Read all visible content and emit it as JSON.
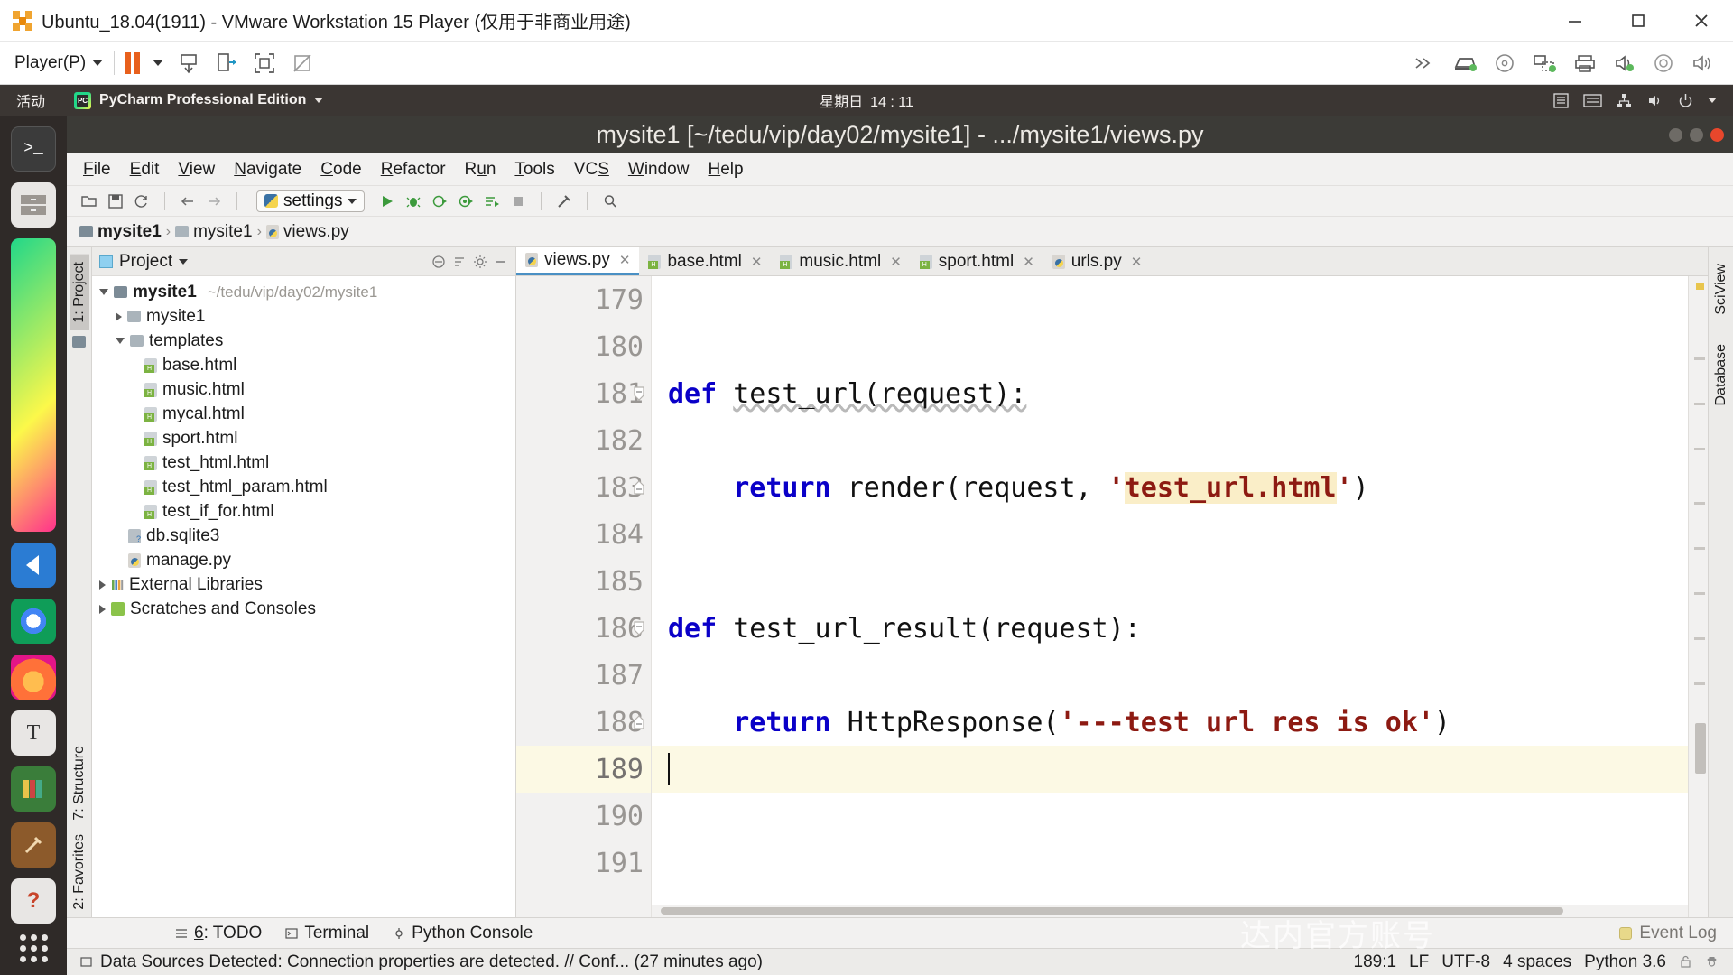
{
  "vmware": {
    "title": "Ubuntu_18.04(1911) - VMware Workstation 15 Player (仅用于非商业用途)",
    "minimize_label": "Minimize",
    "maximize_label": "Maximize",
    "close_label": "Close",
    "player_menu": "Player(P)",
    "toolbar_icons": [
      "pause-icon",
      "dropdown-icon",
      "send-ctrl-alt-del-icon",
      "unity-mode-icon",
      "full-screen-icon",
      "no-preview-icon"
    ],
    "right_icons": [
      "expand-chevrons-icon",
      "hard-disk-icon",
      "cd-dvd-icon",
      "network-adapter-icon",
      "printer-icon",
      "sound-card-icon",
      "usb-device-icon",
      "speaker-icon"
    ]
  },
  "ubuntu": {
    "activities": "活动",
    "app_name": "PyCharm Professional Edition",
    "app_icon": "pycharm-icon",
    "clock_day": "星期日",
    "clock_time": "14 : 11",
    "tray_icons": [
      "keyboard-input-icon",
      "ime-icon",
      "network-icon",
      "volume-icon",
      "power-icon"
    ],
    "launcher_items": [
      {
        "name": "terminal",
        "label": "Terminal"
      },
      {
        "name": "files",
        "label": "Files"
      },
      {
        "name": "pycharm",
        "label": "PyCharm"
      },
      {
        "name": "vscode",
        "label": "Visual Studio Code"
      },
      {
        "name": "chrome",
        "label": "Google Chrome"
      },
      {
        "name": "firefox",
        "label": "Firefox"
      },
      {
        "name": "text-editor",
        "label": "Text Editor"
      },
      {
        "name": "books",
        "label": "Books"
      },
      {
        "name": "tools",
        "label": "Tools"
      },
      {
        "name": "help",
        "label": "Help"
      },
      {
        "name": "show-applications",
        "label": "Show Applications"
      }
    ]
  },
  "pycharm": {
    "window_title": "mysite1 [~/tedu/vip/day02/mysite1] - .../mysite1/views.py",
    "menu": [
      {
        "label": "File",
        "mnemonic": "F"
      },
      {
        "label": "Edit",
        "mnemonic": "E"
      },
      {
        "label": "View",
        "mnemonic": "V"
      },
      {
        "label": "Navigate",
        "mnemonic": "N"
      },
      {
        "label": "Code",
        "mnemonic": "C"
      },
      {
        "label": "Refactor",
        "mnemonic": "R"
      },
      {
        "label": "Run",
        "mnemonic": "u"
      },
      {
        "label": "Tools",
        "mnemonic": "T"
      },
      {
        "label": "VCS",
        "mnemonic": "S"
      },
      {
        "label": "Window",
        "mnemonic": "W"
      },
      {
        "label": "Help",
        "mnemonic": "H"
      }
    ],
    "toolbar": {
      "open_label": "Open",
      "save_label": "Save All",
      "sync_label": "Synchronize",
      "back_label": "Back",
      "forward_label": "Forward",
      "run_config": "settings",
      "run_label": "Run",
      "debug_label": "Debug",
      "run_coverage_label": "Run with Coverage",
      "profile_label": "Profile",
      "attach_label": "Attach to Process",
      "stop_label": "Stop",
      "settings_label": "Settings",
      "search_label": "Search Everywhere"
    },
    "breadcrumb": [
      {
        "label": "mysite1",
        "icon": "folder-icon"
      },
      {
        "label": "mysite1",
        "icon": "folder-icon"
      },
      {
        "label": "views.py",
        "icon": "python-file-icon"
      }
    ],
    "left_tabs": [
      {
        "label": "1: Project",
        "mnemonic": "1",
        "active": true
      },
      {
        "label": "7: Structure",
        "mnemonic": "7",
        "active": false
      },
      {
        "label": "2: Favorites",
        "mnemonic": "2",
        "active": false
      }
    ],
    "right_tabs": [
      {
        "label": "SciView"
      },
      {
        "label": "Database"
      }
    ],
    "project_panel": {
      "title": "Project",
      "header_icons": [
        "collapse-all-icon",
        "sort-icon",
        "settings-gear-icon",
        "hide-icon"
      ],
      "tree": [
        {
          "label": "mysite1",
          "path": "~/tedu/vip/day02/mysite1",
          "indent": 0,
          "state": "open",
          "icon": "folder-icon",
          "bold": true
        },
        {
          "label": "mysite1",
          "path": "",
          "indent": 1,
          "state": "closed",
          "icon": "folder-icon",
          "bold": false
        },
        {
          "label": "templates",
          "path": "",
          "indent": 1,
          "state": "open",
          "icon": "folder-icon",
          "bold": false
        },
        {
          "label": "base.html",
          "path": "",
          "indent": 2,
          "state": "leaf",
          "icon": "html-file-icon",
          "bold": false
        },
        {
          "label": "music.html",
          "path": "",
          "indent": 2,
          "state": "leaf",
          "icon": "html-file-icon",
          "bold": false
        },
        {
          "label": "mycal.html",
          "path": "",
          "indent": 2,
          "state": "leaf",
          "icon": "html-file-icon",
          "bold": false
        },
        {
          "label": "sport.html",
          "path": "",
          "indent": 2,
          "state": "leaf",
          "icon": "html-file-icon",
          "bold": false
        },
        {
          "label": "test_html.html",
          "path": "",
          "indent": 2,
          "state": "leaf",
          "icon": "html-file-icon",
          "bold": false
        },
        {
          "label": "test_html_param.html",
          "path": "",
          "indent": 2,
          "state": "leaf",
          "icon": "html-file-icon",
          "bold": false
        },
        {
          "label": "test_if_for.html",
          "path": "",
          "indent": 2,
          "state": "leaf",
          "icon": "html-file-icon",
          "bold": false
        },
        {
          "label": "db.sqlite3",
          "path": "",
          "indent": 1,
          "state": "leaf",
          "icon": "db-file-icon",
          "bold": false
        },
        {
          "label": "manage.py",
          "path": "",
          "indent": 1,
          "state": "leaf",
          "icon": "python-file-icon",
          "bold": false
        },
        {
          "label": "External Libraries",
          "path": "",
          "indent": 0,
          "state": "closed",
          "icon": "library-icon",
          "bold": false
        },
        {
          "label": "Scratches and Consoles",
          "path": "",
          "indent": 0,
          "state": "closed",
          "icon": "scratch-icon",
          "bold": false
        }
      ]
    },
    "editor_tabs": [
      {
        "label": "views.py",
        "icon": "python-file-icon",
        "active": true
      },
      {
        "label": "base.html",
        "icon": "html-file-icon",
        "active": false
      },
      {
        "label": "music.html",
        "icon": "html-file-icon",
        "active": false
      },
      {
        "label": "sport.html",
        "icon": "html-file-icon",
        "active": false
      },
      {
        "label": "urls.py",
        "icon": "python-file-icon",
        "active": false
      }
    ],
    "code": {
      "lines": [
        {
          "num": "179",
          "tokens": [],
          "fold": "",
          "current": false
        },
        {
          "num": "180",
          "tokens": [],
          "fold": "",
          "current": false
        },
        {
          "num": "181",
          "tokens": [
            {
              "t": "def ",
              "c": "kw"
            },
            {
              "t": "test_url(request):",
              "c": "squig"
            }
          ],
          "fold": "open",
          "current": false
        },
        {
          "num": "182",
          "tokens": [],
          "fold": "",
          "current": false
        },
        {
          "num": "183",
          "tokens": [
            {
              "t": "    return ",
              "c": "kw"
            },
            {
              "t": "render(request, ",
              "c": "fn"
            },
            {
              "t": "'",
              "c": "str"
            },
            {
              "t": "test_url.html",
              "c": "strhl"
            },
            {
              "t": "'",
              "c": "str"
            },
            {
              "t": ")",
              "c": "fn"
            }
          ],
          "fold": "end",
          "current": false
        },
        {
          "num": "184",
          "tokens": [],
          "fold": "",
          "current": false
        },
        {
          "num": "185",
          "tokens": [],
          "fold": "",
          "current": false
        },
        {
          "num": "186",
          "tokens": [
            {
              "t": "def ",
              "c": "kw"
            },
            {
              "t": "test_url_result(request):",
              "c": "fn"
            }
          ],
          "fold": "open",
          "current": false
        },
        {
          "num": "187",
          "tokens": [],
          "fold": "",
          "current": false
        },
        {
          "num": "188",
          "tokens": [
            {
              "t": "    return ",
              "c": "kw"
            },
            {
              "t": "HttpResponse(",
              "c": "fn"
            },
            {
              "t": "'---test url res is ok'",
              "c": "str"
            },
            {
              "t": ")",
              "c": "fn"
            }
          ],
          "fold": "end",
          "current": false
        },
        {
          "num": "189",
          "tokens": [],
          "fold": "",
          "current": true
        },
        {
          "num": "190",
          "tokens": [],
          "fold": "",
          "current": false
        },
        {
          "num": "191",
          "tokens": [],
          "fold": "",
          "current": false
        }
      ]
    },
    "tool_windows": [
      {
        "label": "6: TODO",
        "mnemonic": "6",
        "icon": "todo-icon"
      },
      {
        "label": "Terminal",
        "mnemonic": "",
        "icon": "terminal-icon"
      },
      {
        "label": "Python Console",
        "mnemonic": "",
        "icon": "python-console-icon"
      }
    ],
    "event_log": "Event Log",
    "status_message": "Data Sources Detected: Connection properties are detected. // Conf... (27 minutes ago)",
    "status_right": {
      "caret": "189:1",
      "line_sep": "LF",
      "encoding": "UTF-8",
      "indent": "4 spaces",
      "interpreter": "Python 3.6",
      "lock_icon": "unlocked-icon",
      "inspection_icon": "hector-icon"
    }
  },
  "watermark": {
    "text": "达内官方账号",
    "logo": "play-button-logo"
  },
  "colors": {
    "accent": "#4a90c4",
    "keyword": "#0a00c8",
    "string": "#8d1a12",
    "string_highlight": "#faeec8",
    "current_line": "#fcf9e4",
    "vm_orange": "#e8601c",
    "ubuntu_bar": "#3b3633",
    "pycharm_title": "#3c3b37"
  }
}
